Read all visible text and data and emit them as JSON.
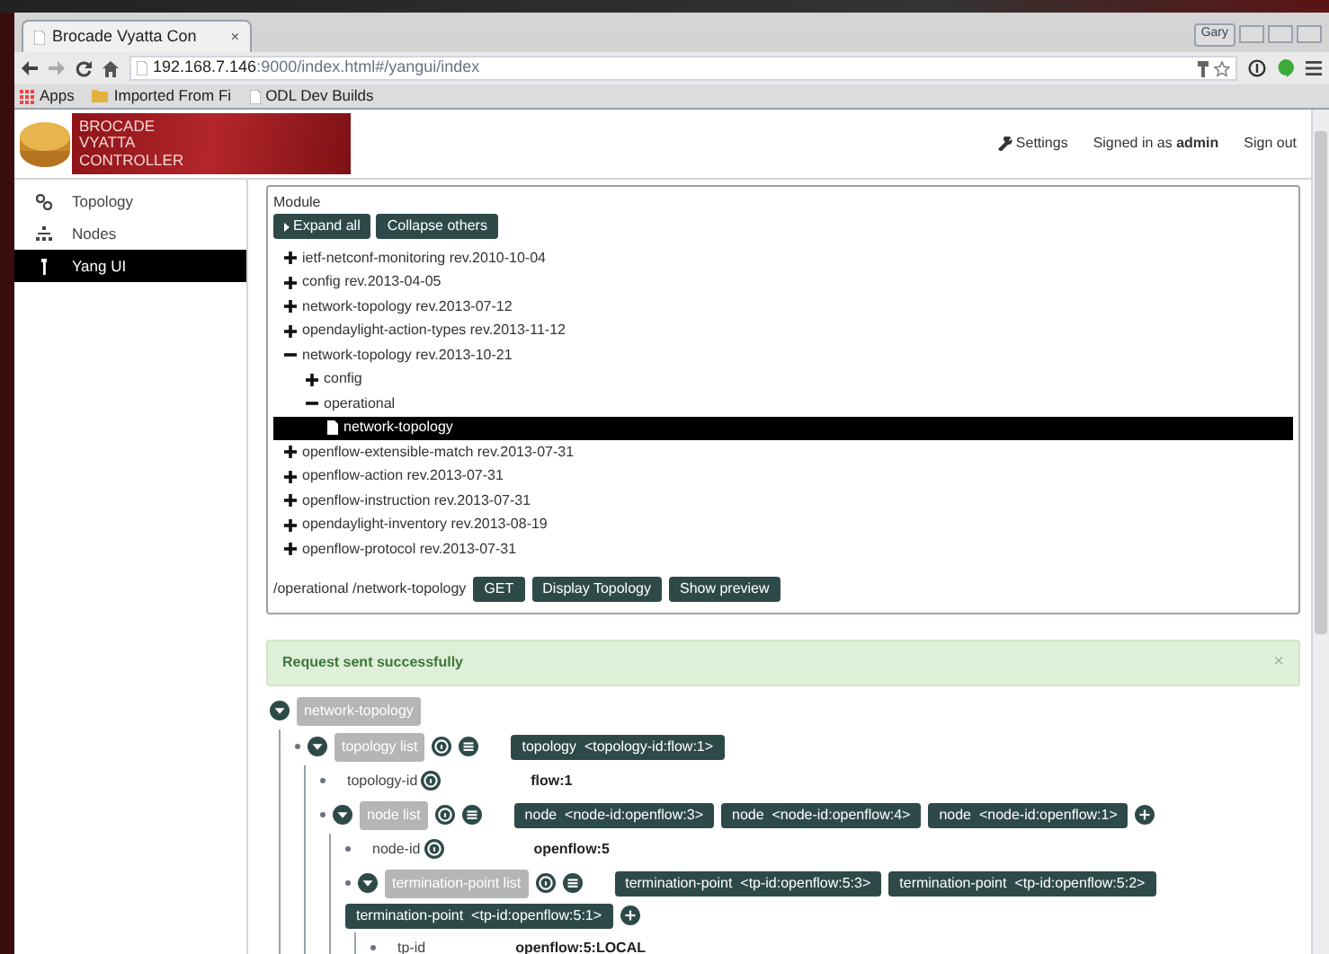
{
  "browser": {
    "tab_title": "Brocade Vyatta Con",
    "tab_close": "×",
    "profile": "Gary",
    "url_host": "192.168.7.146",
    "url_rest": ":9000/index.html#/yangui/index",
    "bookmarks": [
      {
        "label": "Apps",
        "kind": "apps"
      },
      {
        "label": "Imported From Fi",
        "kind": "folder"
      },
      {
        "label": "ODL Dev Builds",
        "kind": "page"
      }
    ]
  },
  "header": {
    "logo_lines": [
      "BROCADE",
      "VYATTA",
      "CONTROLLER"
    ],
    "settings": "Settings",
    "signed_in": "Signed in as **admin**",
    "sign_out": "Sign out"
  },
  "sidebar": {
    "items": [
      {
        "label": "Topology",
        "selected": false
      },
      {
        "label": "Nodes",
        "selected": false
      },
      {
        "label": "Yang UI",
        "selected": true
      }
    ]
  },
  "module": {
    "label": "Module",
    "buttons": [
      "Expand all",
      "Collapse others"
    ],
    "tree": [
      {
        "label": "ietf-netconf-monitoring rev.2010-10-04",
        "expanded": false,
        "selected": false
      },
      {
        "label": "config rev.2013-04-05",
        "expanded": false,
        "selected": false
      },
      {
        "label": "network-topology rev.2013-07-12",
        "expanded": false,
        "selected": false
      },
      {
        "label": "opendaylight-action-types rev.2013-11-12",
        "expanded": false,
        "selected": false
      },
      {
        "label": "network-topology rev.2013-10-21",
        "expanded": true,
        "selected": false,
        "children": [
          {
            "label": "config",
            "expanded": false,
            "selected": false
          },
          {
            "label": "operational",
            "expanded": true,
            "selected": false,
            "children": [
              {
                "label": "network-topology",
                "kind": "file",
                "selected": true
              }
            ]
          }
        ]
      },
      {
        "label": "openflow-extensible-match rev.2013-07-31",
        "expanded": false,
        "selected": false
      },
      {
        "label": "openflow-action rev.2013-07-31",
        "expanded": false,
        "selected": false
      },
      {
        "label": "openflow-instruction rev.2013-07-31",
        "expanded": false,
        "selected": false
      },
      {
        "label": "opendaylight-inventory rev.2013-08-19",
        "expanded": false,
        "selected": false
      },
      {
        "label": "openflow-protocol rev.2013-07-31",
        "expanded": false,
        "selected": false
      }
    ],
    "path": "/operational /network-topology",
    "actions": [
      "GET",
      "Display Topology",
      "Show preview"
    ]
  },
  "alert": {
    "text": "Request sent successfully",
    "close": "×"
  },
  "result": [
    {
      "kind": "container",
      "label": "network-topology",
      "expanded": true,
      "children": [
        {
          "kind": "list",
          "label": "topology list",
          "expanded": true,
          "add": false,
          "entries": [
            {
              "name": "topology",
              "key": "<topology-id:flow:1>"
            }
          ],
          "children": [
            {
              "kind": "leaf",
              "label": "topology-id",
              "help": true,
              "value": "flow:1"
            },
            {
              "kind": "list",
              "label": "node list",
              "expanded": true,
              "add": true,
              "entries": [
                {
                  "name": "node",
                  "key": "<node-id:openflow:3>"
                },
                {
                  "name": "node",
                  "key": "<node-id:openflow:4>"
                },
                {
                  "name": "node",
                  "key": "<node-id:openflow:1>"
                }
              ],
              "children": [
                {
                  "kind": "leaf",
                  "label": "node-id",
                  "help": true,
                  "value": "openflow:5"
                },
                {
                  "kind": "list",
                  "label": "termination-point list",
                  "expanded": true,
                  "add": true,
                  "entries": [
                    {
                      "name": "termination-point",
                      "key": "<tp-id:openflow:5:3>"
                    },
                    {
                      "name": "termination-point",
                      "key": "<tp-id:openflow:5:2>"
                    },
                    {
                      "name": "termination-point",
                      "key": "<tp-id:openflow:5:1>"
                    }
                  ],
                  "children": [
                    {
                      "kind": "leaf",
                      "label": "tp-id",
                      "help": false,
                      "value": "openflow:5:LOCAL"
                    }
                  ]
                }
              ]
            }
          ]
        }
      ]
    }
  ]
}
